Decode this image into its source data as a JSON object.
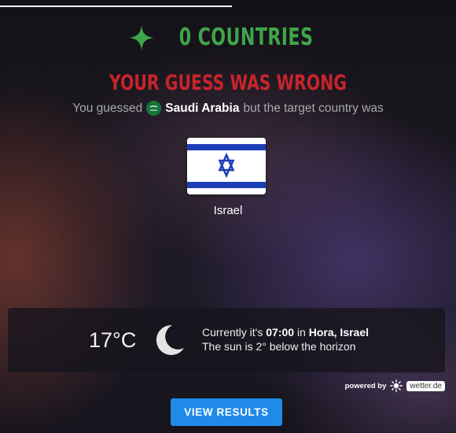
{
  "streak": {
    "text": "0 COUNTRIES",
    "icon": "sparkle-icon",
    "color": "#3fa54a"
  },
  "result": {
    "title": "YOUR GUESS WAS WRONG",
    "title_color": "#c8242a",
    "guess_prefix": "You guessed",
    "guessed_country": "Saudi Arabia",
    "guess_suffix": "but the target country was",
    "target_country": "Israel"
  },
  "weather": {
    "temperature": "17°C",
    "icon": "moon-icon",
    "line1_prefix": "Currently it's",
    "time": "07:00",
    "line1_mid": "in",
    "location": "Hora, Israel",
    "line2": "The sun is 2° below the horizon"
  },
  "powered_by": {
    "label": "powered by",
    "brand": "wetter.de"
  },
  "actions": {
    "view_results": "VIEW RESULTS"
  },
  "colors": {
    "accent": "#1f8ae8"
  }
}
